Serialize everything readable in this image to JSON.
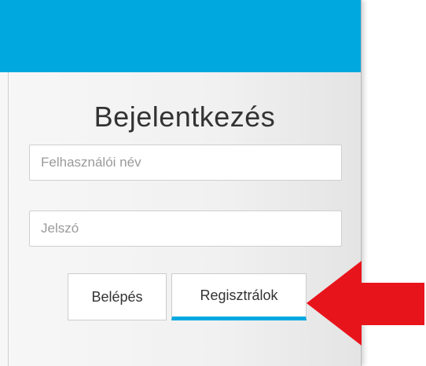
{
  "header": {
    "color": "#00a8e0"
  },
  "login_form": {
    "title": "Bejelentkezés",
    "username_placeholder": "Felhasználói név",
    "password_placeholder": "Jelszó",
    "login_button": "Belépés",
    "register_button": "Regisztrálok"
  },
  "annotation": {
    "icon": "arrow-left-icon",
    "color": "#e8141c"
  }
}
